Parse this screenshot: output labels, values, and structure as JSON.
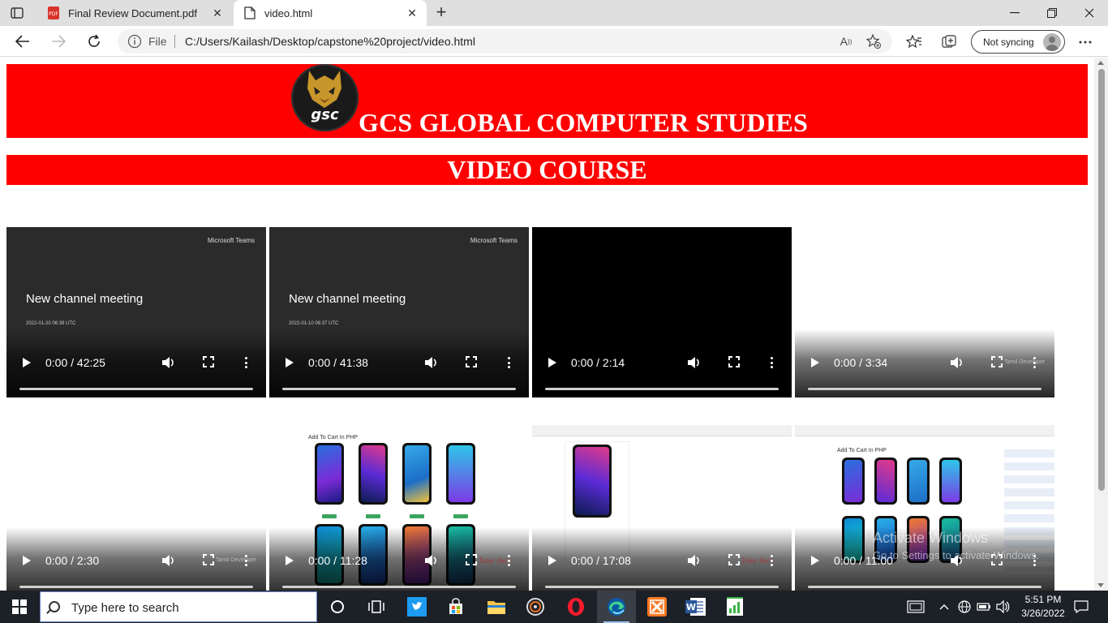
{
  "browser": {
    "tabs": [
      {
        "title": "Final Review Document.pdf",
        "favicon": "pdf-icon",
        "active": false
      },
      {
        "title": "video.html",
        "favicon": "page-icon",
        "active": true
      }
    ],
    "omnibox": {
      "scheme_label": "File",
      "url": "C:/Users/Kailash/Desktop/capstone%20project/video.html"
    },
    "sync_label": "Not syncing"
  },
  "page": {
    "logo_text": "gsc",
    "site_title": "GCS GLOBAL COMPUTER STUDIES",
    "section_title": "VIDEO COURSE",
    "videos": [
      {
        "time": "0:00 / 42:25",
        "thumb": "teams-meeting",
        "thumb_title": "New channel meeting",
        "thumb_date": "2022-01-20 06:39 UTC",
        "thumb_brand": "Microsoft Teams"
      },
      {
        "time": "0:00 / 41:38",
        "thumb": "teams-meeting",
        "thumb_title": "New channel meeting",
        "thumb_date": "2022-01-10 06:37 UTC",
        "thumb_brand": "Microsoft Teams"
      },
      {
        "time": "0:00 / 2:14",
        "thumb": "black"
      },
      {
        "time": "0:00 / 3:34",
        "thumb": "white",
        "watermark": "Tamil Developer"
      },
      {
        "time": "0:00 / 2:30",
        "thumb": "white",
        "watermark": "Tamil Developer"
      },
      {
        "time": "0:00 / 11:28",
        "thumb": "phones",
        "thumb_title": "Add To Cart In PHP",
        "watermark": "Tutor Joe's"
      },
      {
        "time": "0:00 / 17:08",
        "thumb": "phone-detail",
        "watermark": "Tutor Joe's"
      },
      {
        "time": "0:00 / 11:00",
        "thumb": "phones-browser",
        "thumb_title": "Add To Cart In PHP"
      }
    ],
    "activate_title": "Activate Windows",
    "activate_sub": "Go to Settings to activate Windows."
  },
  "taskbar": {
    "search_placeholder": "Type here to search",
    "time": "5:51 PM",
    "date": "3/26/2022",
    "apps": [
      "task-view-icon",
      "twitter-icon",
      "store-icon",
      "file-explorer-icon",
      "media-player-icon",
      "opera-icon",
      "edge-icon",
      "xampp-icon",
      "word-icon",
      "sheets-icon"
    ]
  },
  "colors": {
    "banner_red": "#ff0000",
    "taskbar_bg": "#1c2027",
    "edge_blue": "#0c59a4"
  }
}
